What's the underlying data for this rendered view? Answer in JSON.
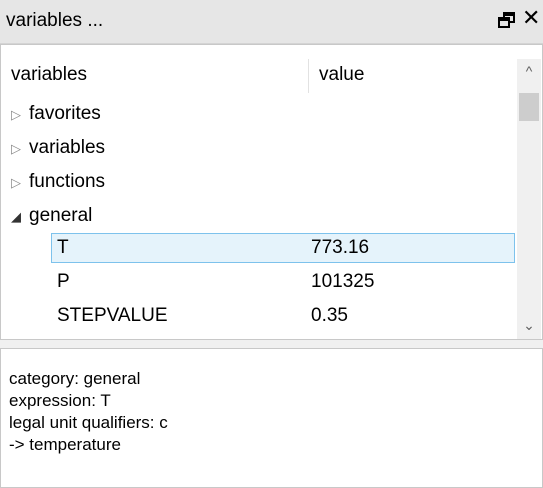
{
  "window": {
    "title": "variables ...",
    "restore_icon": "restore-window-icon",
    "close_glyph": "✕"
  },
  "tree": {
    "columns": [
      "variables",
      "value"
    ],
    "nodes": [
      {
        "label": "favorites",
        "state": "collapsed",
        "toggle": "▷"
      },
      {
        "label": "variables",
        "state": "collapsed",
        "toggle": "▷"
      },
      {
        "label": "functions",
        "state": "collapsed",
        "toggle": "▷"
      },
      {
        "label": "general",
        "state": "expanded",
        "toggle": "◢"
      }
    ],
    "children": [
      {
        "name": "T",
        "value": "773.16",
        "selected": true
      },
      {
        "name": "P",
        "value": "101325",
        "selected": false
      },
      {
        "name": "STEPVALUE",
        "value": "0.35",
        "selected": false
      }
    ],
    "scrollbar": {
      "up": "^",
      "down": "⌄"
    }
  },
  "info": {
    "lines": [
      "category: general",
      "expression: T",
      "legal unit qualifiers: c",
      "-> temperature"
    ]
  },
  "colors": {
    "selection_bg": "#e5f3fb",
    "selection_border": "#7dc2ec",
    "titlebar_bg": "#e6e6e6"
  }
}
